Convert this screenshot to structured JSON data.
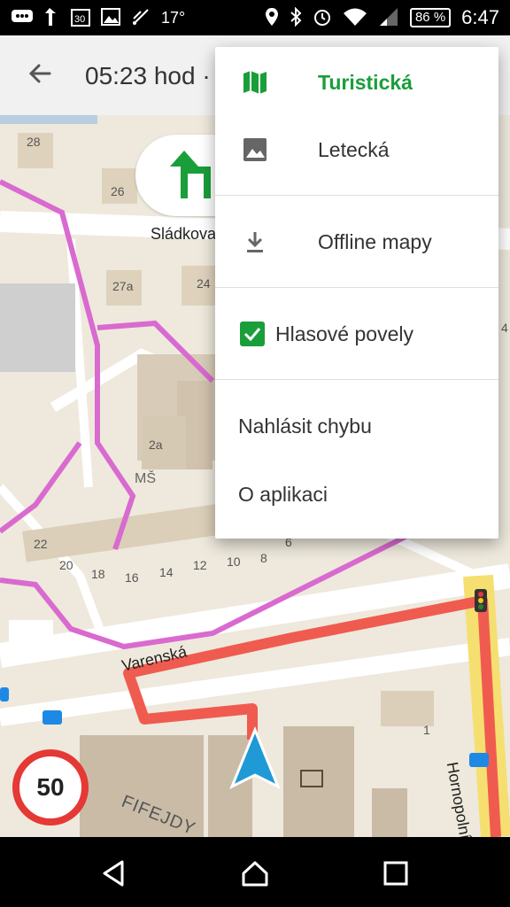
{
  "status_bar": {
    "temperature": "17°",
    "battery": "86 %",
    "time": "6:47"
  },
  "app_bar": {
    "eta": "05:23 hod ·"
  },
  "map": {
    "labels": {
      "street_top": "Sládkova",
      "street_bottom": "Varenská",
      "street_right": "Hornopolní",
      "district": "FIFEJDY",
      "school": "MŠ"
    },
    "house_numbers": [
      "28",
      "26",
      "27a",
      "24",
      "2a",
      "22",
      "20",
      "18",
      "16",
      "14",
      "12",
      "10",
      "8",
      "6",
      "4",
      "1"
    ],
    "speed_limit": "50"
  },
  "menu": {
    "items": [
      {
        "label": "Turistická",
        "icon": "map-icon",
        "selected": true
      },
      {
        "label": "Letecká",
        "icon": "image-icon",
        "selected": false
      },
      {
        "label": "Offline mapy",
        "icon": "download-icon",
        "selected": false
      },
      {
        "label": "Hlasové povely",
        "icon": "checkbox-icon",
        "checked": true
      },
      {
        "label": "Nahlásit chybu"
      },
      {
        "label": "O aplikaci"
      }
    ]
  },
  "colors": {
    "accent_green": "#1a9e3a",
    "route_red": "#f05b4f",
    "pink_path": "#d96ad0",
    "speed_red": "#e53935"
  }
}
